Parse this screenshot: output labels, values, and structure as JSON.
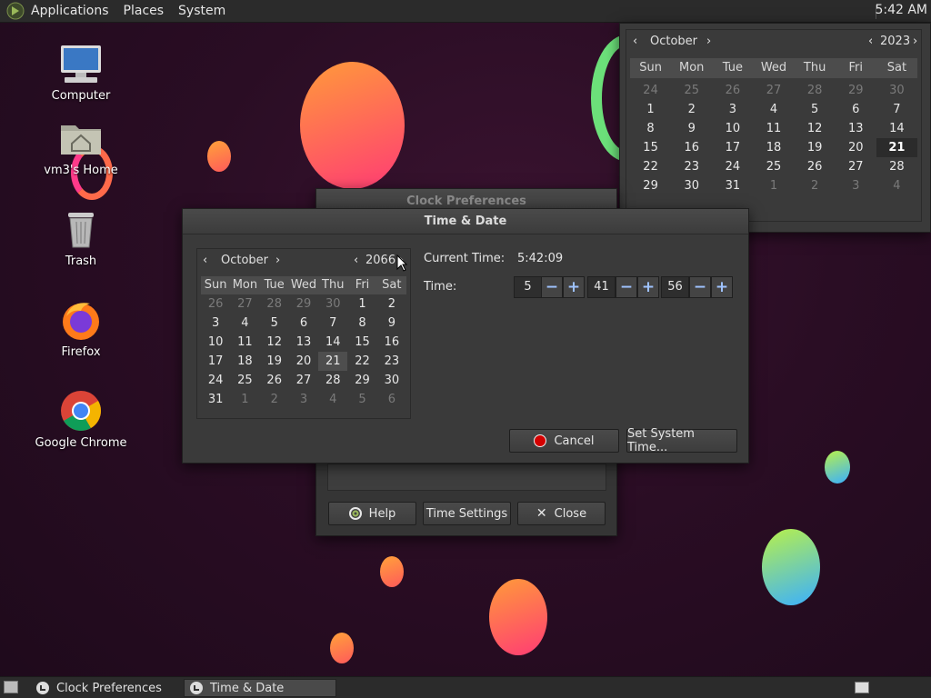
{
  "top_panel": {
    "menus": [
      "Applications",
      "Places",
      "System"
    ],
    "clock": "5:42 AM"
  },
  "desktop": {
    "icons": [
      {
        "label": "Computer",
        "icon": "computer-icon"
      },
      {
        "label": "vm3's Home",
        "icon": "home-folder-icon"
      },
      {
        "label": "Trash",
        "icon": "trash-icon"
      },
      {
        "label": "Firefox",
        "icon": "firefox-icon"
      },
      {
        "label": "Google Chrome",
        "icon": "chrome-icon"
      }
    ]
  },
  "panel_calendar": {
    "month": "October",
    "year": "2023",
    "day_names": [
      "Sun",
      "Mon",
      "Tue",
      "Wed",
      "Thu",
      "Fri",
      "Sat"
    ],
    "days": [
      "24",
      "25",
      "26",
      "27",
      "28",
      "29",
      "30",
      "1",
      "2",
      "3",
      "4",
      "5",
      "6",
      "7",
      "8",
      "9",
      "10",
      "11",
      "12",
      "13",
      "14",
      "15",
      "16",
      "17",
      "18",
      "19",
      "20",
      "21",
      "22",
      "23",
      "24",
      "25",
      "26",
      "27",
      "28",
      "29",
      "30",
      "31",
      "1",
      "2",
      "3",
      "4"
    ]
  },
  "clock_prefs": {
    "title": "Clock Preferences",
    "help_label": "Help",
    "time_settings_label": "Time Settings",
    "close_label": "Close"
  },
  "time_date": {
    "title": "Time & Date",
    "month": "October",
    "year": "2066",
    "day_names": [
      "Sun",
      "Mon",
      "Tue",
      "Wed",
      "Thu",
      "Fri",
      "Sat"
    ],
    "days": [
      "26",
      "27",
      "28",
      "29",
      "30",
      "1",
      "2",
      "3",
      "4",
      "5",
      "6",
      "7",
      "8",
      "9",
      "10",
      "11",
      "12",
      "13",
      "14",
      "15",
      "16",
      "17",
      "18",
      "19",
      "20",
      "21",
      "22",
      "23",
      "24",
      "25",
      "26",
      "27",
      "28",
      "29",
      "30",
      "31",
      "1",
      "2",
      "3",
      "4",
      "5",
      "6"
    ],
    "current_time_label": "Current Time:",
    "current_time_value": "5:42:09",
    "time_label": "Time:",
    "hours": "5",
    "minutes": "41",
    "seconds": "56",
    "cancel_label": "Cancel",
    "set_label": "Set System Time..."
  },
  "taskbar": {
    "items": [
      {
        "label": "Clock Preferences"
      },
      {
        "label": "Time & Date"
      }
    ]
  },
  "colors": {
    "accent_blue": "#9fc3ff",
    "cancel_red": "#d40000"
  }
}
